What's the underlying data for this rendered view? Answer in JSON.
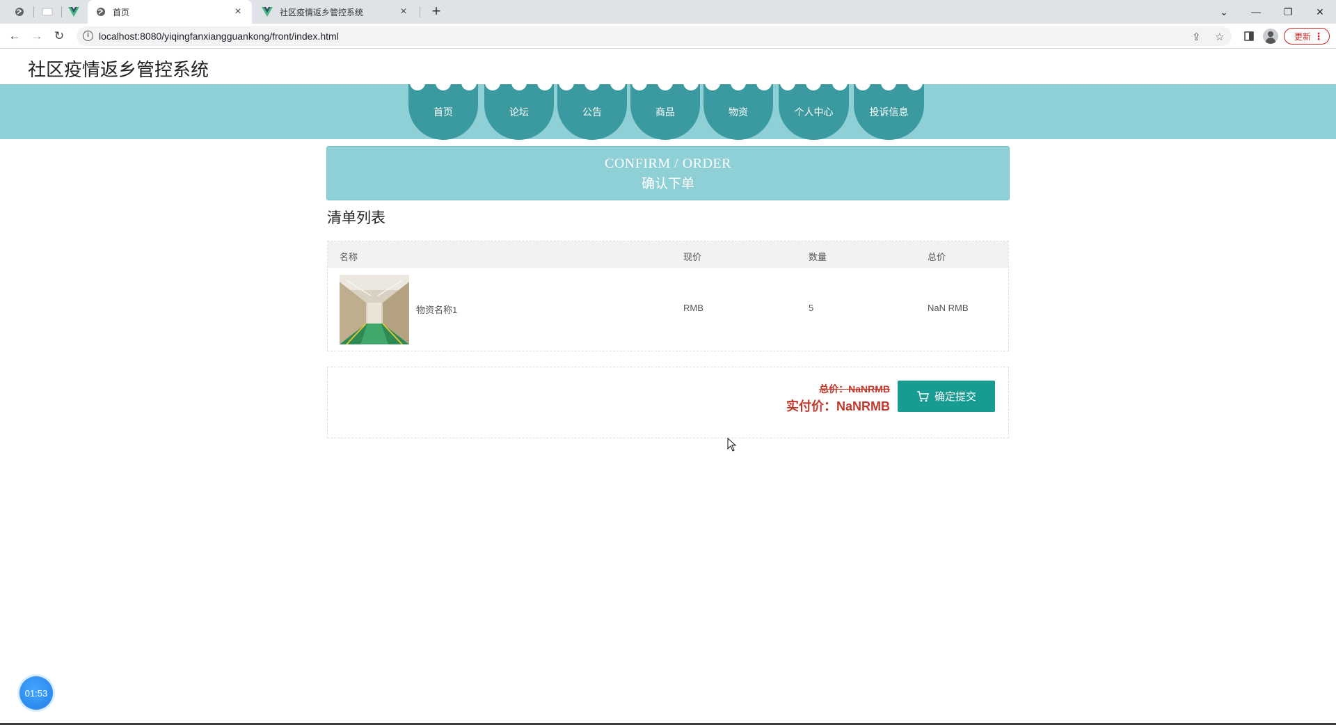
{
  "browser": {
    "tabs": [
      {
        "title": "首页",
        "active": true
      },
      {
        "title": "社区疫情返乡管控系统",
        "active": false
      }
    ],
    "url": "localhost:8080/yiqingfanxiangguankong/front/index.html",
    "update_label": "更新"
  },
  "site": {
    "title": "社区疫情返乡管控系统",
    "nav": [
      "首页",
      "论坛",
      "公告",
      "商品",
      "物资",
      "个人中心",
      "投诉信息"
    ]
  },
  "banner": {
    "title_en": "CONFIRM / ORDER",
    "title_cn": "确认下单"
  },
  "order": {
    "list_title": "清单列表",
    "headers": {
      "name": "名称",
      "price": "现价",
      "qty": "数量",
      "total": "总价"
    },
    "rows": [
      {
        "name": "物资名称1",
        "price": "RMB",
        "qty": "5",
        "total": "NaN RMB"
      }
    ],
    "total_label": "总价：NaNRMB",
    "paid_label": "实付价：NaNRMB",
    "submit_label": "确定提交"
  },
  "timer": "01:53",
  "colors": {
    "accent": "#179b93",
    "nav_band": "#8fd0d6",
    "nav_item": "#3a9aa0",
    "price_red": "#c0392b"
  }
}
